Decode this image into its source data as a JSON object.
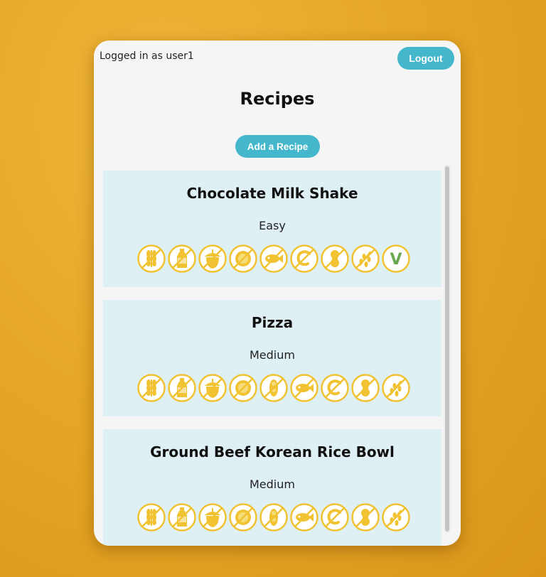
{
  "header": {
    "user_text": "Logged in as user1",
    "logout_label": "Logout"
  },
  "page": {
    "title": "Recipes",
    "add_label": "Add a Recipe"
  },
  "colors": {
    "accent": "#45b7cd",
    "card_bg": "#dff0f5",
    "icon_yellow": "#f1c232",
    "vegan_green": "#6aa84f",
    "background": "#e6a726"
  },
  "recipes": [
    {
      "name": "Chocolate Milk Shake",
      "difficulty": "Easy",
      "icons": [
        "wheat-free-icon",
        "dairy-free-icon",
        "nut-free-icon",
        "egg-free-icon",
        "fish-free-icon",
        "shellfish-free-icon",
        "peanut-free-icon",
        "sesame-free-icon",
        "vegan-icon"
      ],
      "vegan_letter": "V"
    },
    {
      "name": "Pizza",
      "difficulty": "Medium",
      "icons": [
        "wheat-free-icon",
        "dairy-free-icon",
        "nut-free-icon",
        "egg-free-icon",
        "soy-free-icon",
        "fish-free-icon",
        "shellfish-free-icon",
        "peanut-free-icon",
        "sesame-free-icon"
      ]
    },
    {
      "name": "Ground Beef Korean Rice Bowl",
      "difficulty": "Medium",
      "icons": [
        "wheat-free-icon",
        "dairy-free-icon",
        "nut-free-icon",
        "egg-free-icon",
        "soy-free-icon",
        "fish-free-icon",
        "shellfish-free-icon",
        "peanut-free-icon",
        "sesame-free-icon"
      ]
    }
  ]
}
